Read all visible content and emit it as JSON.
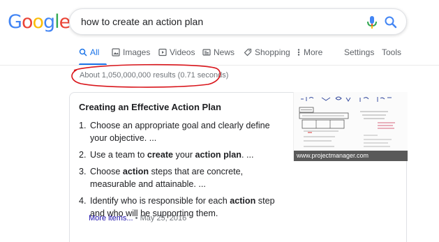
{
  "logo": {
    "letters": [
      "G",
      "o",
      "o",
      "g",
      "l",
      "e"
    ],
    "colors": [
      "#4285F4",
      "#EA4335",
      "#FBBC05",
      "#4285F4",
      "#34A853",
      "#EA4335"
    ]
  },
  "search": {
    "query": "how to create an action plan"
  },
  "nav": {
    "tabs": [
      {
        "label": "All",
        "icon": "search-icon"
      },
      {
        "label": "Images",
        "icon": "image-icon"
      },
      {
        "label": "Videos",
        "icon": "play-icon"
      },
      {
        "label": "News",
        "icon": "newspaper-icon"
      },
      {
        "label": "Shopping",
        "icon": "tag-icon"
      },
      {
        "label": "More",
        "icon": "dots-vertical-icon"
      }
    ],
    "settings": "Settings",
    "tools": "Tools"
  },
  "stats": "About 1,050,000,000 results (0.71 seconds)",
  "snippet": {
    "title": "Creating an Effective Action Plan",
    "items": [
      {
        "n": "1.",
        "parts": [
          [
            "Choose an appropriate goal and clearly define your objective. ...",
            false
          ]
        ]
      },
      {
        "n": "2.",
        "parts": [
          [
            "Use a team to ",
            false
          ],
          [
            "create",
            true
          ],
          [
            " your ",
            false
          ],
          [
            "action plan",
            true
          ],
          [
            ". ...",
            false
          ]
        ]
      },
      {
        "n": "3.",
        "parts": [
          [
            "Choose ",
            false
          ],
          [
            "action",
            true
          ],
          [
            " steps that are concrete, measurable and attainable. ...",
            false
          ]
        ]
      },
      {
        "n": "4.",
        "parts": [
          [
            "Identify who is responsible for each ",
            false
          ],
          [
            "action",
            true
          ],
          [
            " step and who will be supporting them.",
            false
          ]
        ]
      }
    ],
    "more_label": "More items...",
    "date": "May 25, 2016",
    "image_caption": "www.projectmanager.com"
  },
  "colors": {
    "accent": "#1a73e8",
    "link": "#1a0dab",
    "annotation": "#d9151b"
  }
}
